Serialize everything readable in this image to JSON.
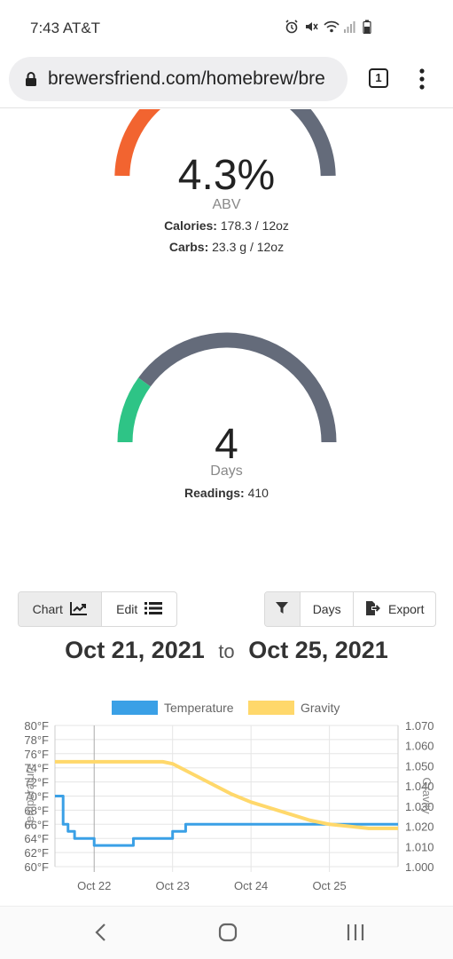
{
  "status_bar": {
    "time": "7:43 AT&T",
    "icons": [
      "alarm-icon",
      "mute-icon",
      "wifi-icon",
      "signal-icon",
      "battery-icon"
    ]
  },
  "browser": {
    "url": "brewersfriend.com/homebrew/bre",
    "tab_count": "1"
  },
  "abv_gauge": {
    "value": "4.3%",
    "unit": "ABV",
    "calories_label": "Calories:",
    "calories_value": "178.3 / 12oz",
    "carbs_label": "Carbs:",
    "carbs_value": "23.3 g / 12oz",
    "colors": {
      "fill": "#f26430",
      "track": "#646b7a"
    }
  },
  "days_gauge": {
    "value": "4",
    "unit": "Days",
    "readings_label": "Readings:",
    "readings_value": "410",
    "fill_fraction": 0.2,
    "colors": {
      "fill": "#2ec486",
      "track": "#646b7a"
    }
  },
  "controls": {
    "chart_label": "Chart",
    "edit_label": "Edit",
    "days_label": "Days",
    "export_label": "Export"
  },
  "date_range": {
    "start": "Oct 21, 2021",
    "to": "to",
    "end": "Oct 25, 2021"
  },
  "chart_data": {
    "type": "line",
    "legend_position": "top",
    "left_axis_label": "Temperature",
    "right_axis_label": "Gravity",
    "y_left_ticks": [
      "80°F",
      "78°F",
      "76°F",
      "74°F",
      "72°F",
      "70°F",
      "68°F",
      "66°F",
      "64°F",
      "62°F",
      "60°F"
    ],
    "y_left_range": [
      60,
      80
    ],
    "y_right_ticks": [
      "1.070",
      "1.060",
      "1.050",
      "1.040",
      "1.030",
      "1.020",
      "1.010",
      "1.000"
    ],
    "y_right_range": [
      1.0,
      1.07
    ],
    "x_tick_labels": [
      "Oct 22",
      "Oct 23",
      "Oct 24",
      "Oct 25"
    ],
    "x_range": [
      "2021-10-21 12:00",
      "2021-10-25 21:00"
    ],
    "grid": true,
    "series": [
      {
        "name": "Temperature",
        "color": "#3aa0e6",
        "axis": "left",
        "points": [
          [
            "2021-10-21 12:00",
            70
          ],
          [
            "2021-10-21 13:00",
            70
          ],
          [
            "2021-10-21 14:30",
            66
          ],
          [
            "2021-10-21 16:00",
            65
          ],
          [
            "2021-10-21 18:00",
            64
          ],
          [
            "2021-10-22 00:00",
            63
          ],
          [
            "2021-10-22 10:00",
            63
          ],
          [
            "2021-10-22 12:00",
            64
          ],
          [
            "2021-10-22 16:00",
            64
          ],
          [
            "2021-10-22 22:00",
            64
          ],
          [
            "2021-10-23 00:00",
            65
          ],
          [
            "2021-10-23 04:00",
            66
          ],
          [
            "2021-10-23 12:00",
            66
          ],
          [
            "2021-10-24 12:00",
            66
          ],
          [
            "2021-10-25 12:00",
            66
          ],
          [
            "2021-10-25 21:00",
            66
          ]
        ]
      },
      {
        "name": "Gravity",
        "color": "#ffd86b",
        "axis": "right",
        "points": [
          [
            "2021-10-21 12:00",
            1.052
          ],
          [
            "2021-10-22 12:00",
            1.052
          ],
          [
            "2021-10-22 21:00",
            1.052
          ],
          [
            "2021-10-23 00:00",
            1.051
          ],
          [
            "2021-10-23 06:00",
            1.046
          ],
          [
            "2021-10-23 12:00",
            1.041
          ],
          [
            "2021-10-23 18:00",
            1.036
          ],
          [
            "2021-10-24 00:00",
            1.032
          ],
          [
            "2021-10-24 06:00",
            1.029
          ],
          [
            "2021-10-24 12:00",
            1.026
          ],
          [
            "2021-10-24 18:00",
            1.023
          ],
          [
            "2021-10-25 00:00",
            1.021
          ],
          [
            "2021-10-25 06:00",
            1.02
          ],
          [
            "2021-10-25 12:00",
            1.019
          ],
          [
            "2021-10-25 21:00",
            1.019
          ]
        ]
      }
    ]
  }
}
